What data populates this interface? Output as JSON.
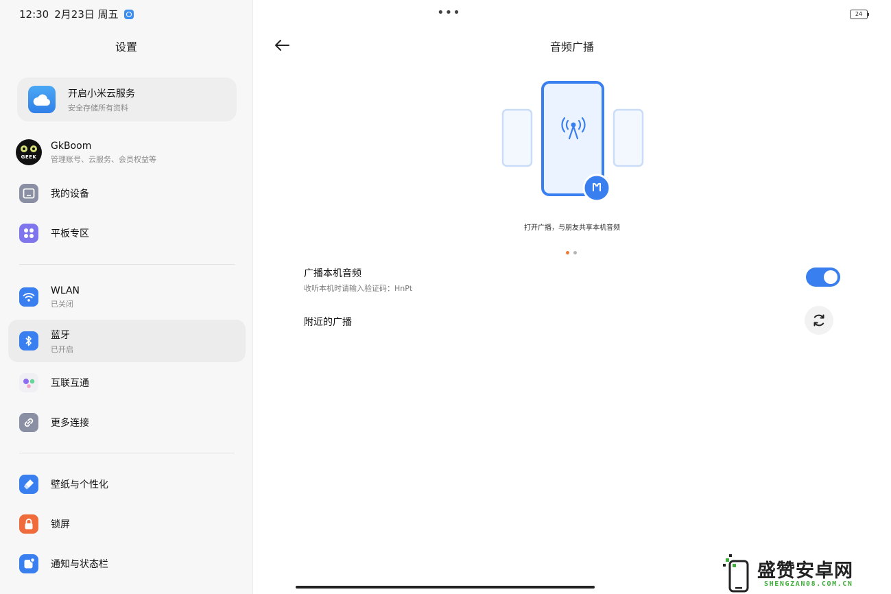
{
  "status_bar": {
    "time": "12:30",
    "date": "2月23日 周五",
    "battery": "24"
  },
  "sidebar": {
    "title": "设置",
    "cloud_card": {
      "title": "开启小米云服务",
      "subtitle": "安全存储所有资料"
    },
    "account": {
      "name": "GkBoom",
      "subtitle": "管理账号、云服务、会员权益等",
      "avatar_text": "GEEK"
    },
    "items": [
      {
        "label": "我的设备",
        "sub": ""
      },
      {
        "label": "平板专区",
        "sub": ""
      },
      {
        "label": "WLAN",
        "sub": "已关闭"
      },
      {
        "label": "蓝牙",
        "sub": "已开启"
      },
      {
        "label": "互联互通",
        "sub": ""
      },
      {
        "label": "更多连接",
        "sub": ""
      },
      {
        "label": "壁纸与个性化",
        "sub": ""
      },
      {
        "label": "锁屏",
        "sub": ""
      },
      {
        "label": "通知与状态栏",
        "sub": ""
      }
    ]
  },
  "main": {
    "title": "音频广播",
    "illustration_caption": "打开广播，与朋友共享本机音频",
    "broadcast": {
      "title": "广播本机音频",
      "subtitle": "收听本机时请输入验证码：HnPt",
      "enabled": true
    },
    "nearby": {
      "title": "附近的广播"
    }
  },
  "watermark": {
    "cn": "盛赞安卓网",
    "en": "SHENGZAN08.COM.CN"
  },
  "colors": {
    "accent": "#3a7ff0",
    "pager_active": "#f07a3a",
    "pager_inactive": "#b5b5b5",
    "watermark_green": "#3fae3a"
  },
  "icons": {
    "back": "arrow-left-icon",
    "more": "more-dots-icon",
    "refresh": "refresh-icon",
    "cloud": "cloud-icon",
    "devices": "tablet-icon",
    "tablet_zone": "grid-icon",
    "wlan": "wifi-icon",
    "bluetooth": "bluetooth-icon",
    "interconnect": "interconnect-icon",
    "more_connect": "link-icon",
    "wallpaper": "brush-icon",
    "lock": "lock-icon",
    "notification": "notification-icon"
  }
}
